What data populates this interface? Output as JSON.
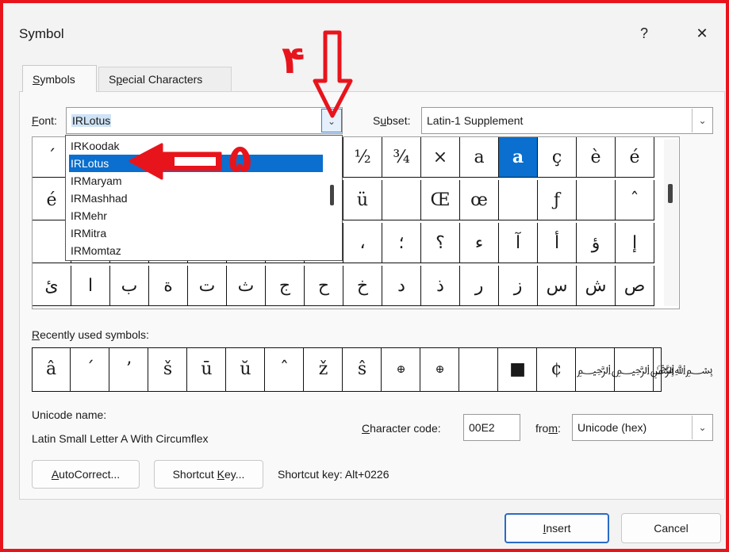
{
  "dialog": {
    "title": "Symbol",
    "help_label": "?",
    "close_label": "✕",
    "tabs": [
      {
        "label": "Symbols",
        "access": "S",
        "rest": "ymbols",
        "active": true
      },
      {
        "label": "Special Characters",
        "pre": "S",
        "access": "p",
        "rest": "ecial Characters",
        "active": false
      }
    ]
  },
  "font": {
    "label_access": "F",
    "label_rest": "ont:",
    "value": "IRLotus"
  },
  "subset": {
    "label_pre": "S",
    "label_access": "u",
    "label_rest": "bset:",
    "value": "Latin-1 Supplement"
  },
  "font_dropdown": {
    "items": [
      {
        "label": "IRKoodak",
        "selected": false
      },
      {
        "label": "IRLotus",
        "selected": true
      },
      {
        "label": "IRMaryam",
        "selected": false
      },
      {
        "label": "IRMashhad",
        "selected": false
      },
      {
        "label": "IRMehr",
        "selected": false
      },
      {
        "label": "IRMitra",
        "selected": false
      },
      {
        "label": "IRMomtaz",
        "selected": false
      }
    ]
  },
  "symbol_grid": {
    "rows": [
      [
        "´",
        "",
        "",
        "",
        "",
        "",
        "",
        "",
        "½",
        "¾",
        "×",
        "a",
        "a",
        "ç",
        "è",
        "é"
      ],
      [
        "é",
        "",
        "",
        "",
        "",
        "",
        "",
        "",
        "ü",
        "",
        "Œ",
        "œ",
        "",
        "ƒ",
        "",
        "ˆ"
      ],
      [
        "",
        "",
        "",
        "",
        "",
        "",
        "",
        "",
        "،",
        "؛",
        "؟",
        "ء",
        "آ",
        "أ",
        "ؤ",
        "إ"
      ],
      [
        "ئ",
        "ا",
        "ب",
        "ة",
        "ت",
        "ث",
        "ج",
        "ح",
        "خ",
        "د",
        "ذ",
        "ر",
        "ز",
        "س",
        "ش",
        "ص"
      ]
    ],
    "selected_row": 0,
    "selected_col": 12
  },
  "recent": {
    "label_access": "R",
    "label_rest": "ecently used symbols:",
    "symbols": [
      "â",
      "´",
      "’",
      "š",
      "ū",
      "ŭ",
      "ˆ",
      "ž",
      "ŝ",
      "⊕",
      "⊕",
      "",
      "■",
      "¢",
      "﷽",
      "﷽"
    ]
  },
  "unicode_name_label": "Unicode name:",
  "unicode_name_value": "Latin Small Letter A With Circumflex",
  "character_code": {
    "label_access": "C",
    "label_rest": "haracter code:",
    "value": "00E2"
  },
  "from": {
    "label_pre": "fro",
    "label_access": "m",
    "label_rest": ":",
    "value": "Unicode (hex)"
  },
  "buttons": {
    "autocorrect": {
      "access": "A",
      "rest": "utoCorrect..."
    },
    "shortcut_key": {
      "pre": "Shortcut ",
      "access": "K",
      "rest": "ey..."
    },
    "shortcut_text": "Shortcut key: Alt+0226",
    "insert": {
      "access": "I",
      "rest": "nsert"
    },
    "cancel": "Cancel"
  },
  "annotations": {
    "step4": "۴",
    "step5": "۵"
  },
  "colors": {
    "annotation": "#e8141c",
    "selection": "#0a6fce",
    "primary_border": "#2a6bc6"
  }
}
